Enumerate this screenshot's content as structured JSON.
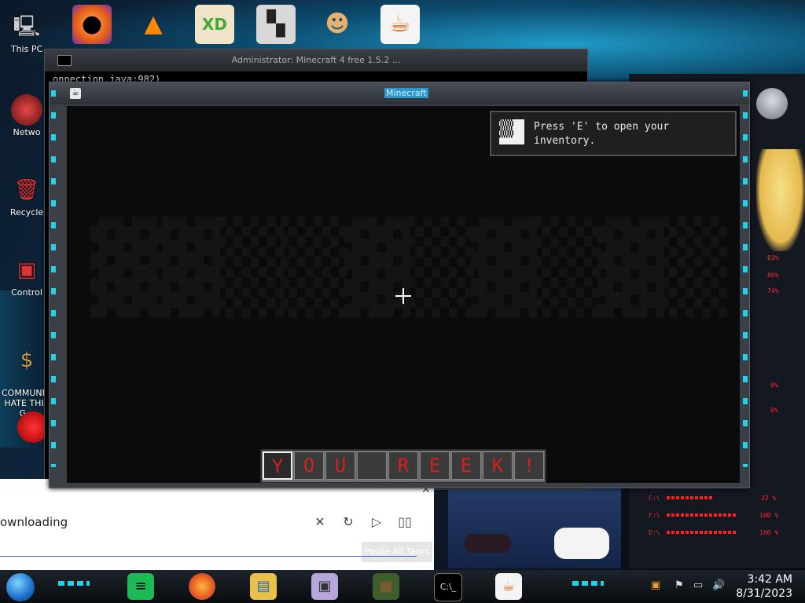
{
  "desktop": {
    "icons": [
      {
        "label": "This PC"
      },
      {
        "label": "Netwo"
      },
      {
        "label": "Recycle"
      },
      {
        "label": "Control"
      },
      {
        "label": "COMMUNIST\nHATE THIS G..."
      }
    ],
    "top_icons": [
      "firefox-icon",
      "vlc-icon",
      "xd-icon",
      "app-icon",
      "doctor-icon",
      "java-icon"
    ]
  },
  "console": {
    "title": "Administrator: Minecraft 4 free 1.5.2 ...",
    "line": "onnection.java:982)"
  },
  "minecraft": {
    "title": "Minecraft",
    "toast": "Press 'E' to open your inventory.",
    "hotbar": [
      "Y",
      "O",
      "U",
      "",
      "R",
      "E",
      "E",
      "K",
      "!"
    ],
    "selected_slot": 0
  },
  "download_panel": {
    "status": "ownloading",
    "pause_all": "Pause All Tasks"
  },
  "gadget": {
    "stats": [
      "83%",
      "86%",
      "74%",
      "0%",
      "0%",
      "32 %",
      "100 %",
      "100 %"
    ]
  },
  "taskbar": {
    "time": "3:42 AM",
    "date": "8/31/2023"
  }
}
